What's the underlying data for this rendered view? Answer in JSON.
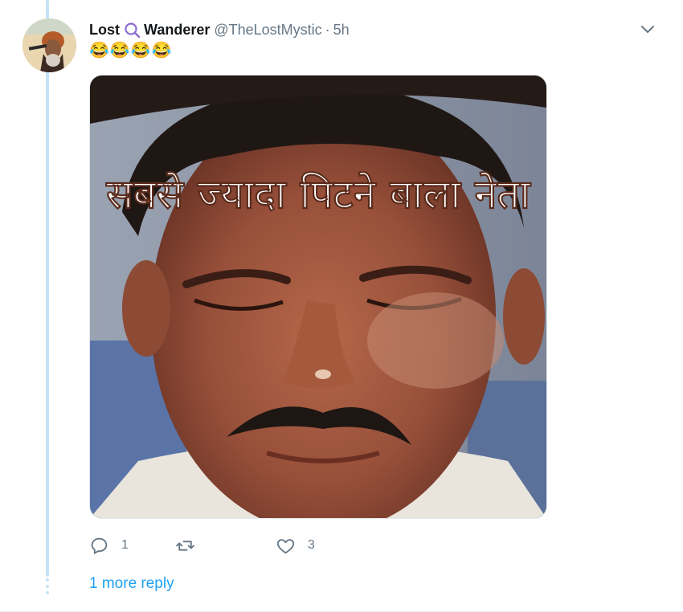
{
  "tweet": {
    "name_part1": "Lost",
    "name_part2": "Wanderer",
    "handle": "@TheLostMystic",
    "separator": "·",
    "time": "5h",
    "text": "😂😂😂😂",
    "media_caption": "सबसे ज्यादा पिटने बाला नेता",
    "icons": {
      "avatar": "avatar-image",
      "name_emblem": "magnifier-icon",
      "menu": "chevron-down-icon",
      "reply": "reply-icon",
      "retweet": "retweet-icon",
      "like": "heart-icon"
    },
    "stats": {
      "replies": "1",
      "retweets": "",
      "likes": "3"
    }
  },
  "thread": {
    "more_replies_label": "1 more reply"
  },
  "colors": {
    "link": "#1da1f2",
    "muted": "#657786",
    "thread_line": "#c4e3f7",
    "name_icon": "#8e6bd1"
  }
}
